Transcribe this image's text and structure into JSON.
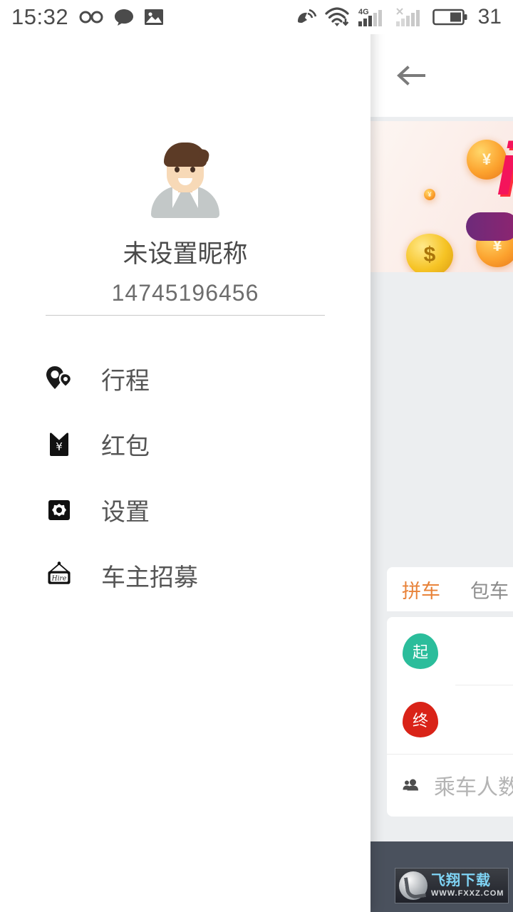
{
  "status_bar": {
    "time": "15:32",
    "battery_level": "31",
    "left_icons": [
      "infinity-icon",
      "message-bubble-icon",
      "photo-icon"
    ],
    "right_icons": [
      "location-satellite-icon",
      "wifi-icon",
      "signal-4g-icon",
      "signal-no-service-icon",
      "battery-icon"
    ],
    "network_label": "4G"
  },
  "drawer": {
    "profile": {
      "nickname": "未设置昵称",
      "phone": "14745196456",
      "avatar_icon": "user-avatar-illustration"
    },
    "menu": [
      {
        "label": "行程",
        "icon": "location-pin-icon"
      },
      {
        "label": "红包",
        "icon": "red-packet-icon"
      },
      {
        "label": "设置",
        "icon": "gear-icon"
      },
      {
        "label": "车主招募",
        "icon": "hire-sign-icon"
      }
    ]
  },
  "app": {
    "back_icon": "back-arrow-icon",
    "banner": {
      "headline": "i",
      "coin_symbols": [
        "¥",
        "¥",
        "$",
        "¥",
        "¥"
      ]
    },
    "tabs": [
      {
        "label": "拼车",
        "active": true
      },
      {
        "label": "包车",
        "active": false
      }
    ],
    "form": {
      "start_pin_label": "起",
      "end_pin_label": "终",
      "passengers_label": "乘车人数",
      "passengers_icon": "people-icon"
    }
  },
  "watermark": {
    "title": "飞翔下载",
    "url": "WWW.FXXZ.COM",
    "logo_icon": "fxxz-logo-icon"
  },
  "colors": {
    "accent_orange": "#e8833a",
    "start_pin": "#2bbd9b",
    "end_pin": "#d92318",
    "banner_pink": "#f4145b",
    "nav_bar": "#4a515d",
    "text_primary": "#4a4a4a",
    "text_secondary": "#6d6d6d"
  }
}
